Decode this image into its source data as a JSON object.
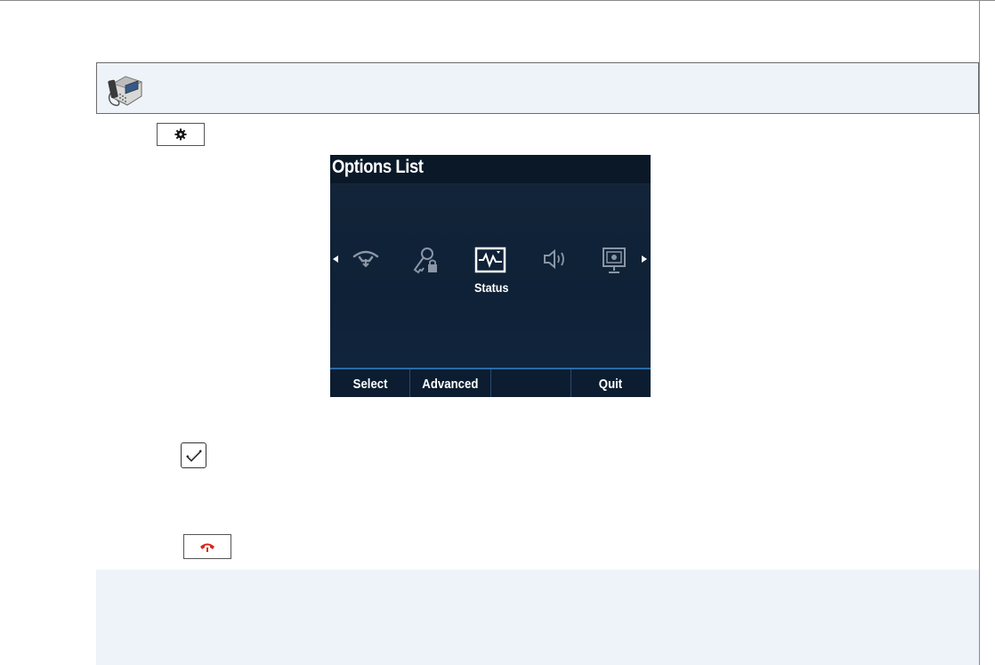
{
  "screen": {
    "title": "Options List",
    "icons": [
      "network-icon",
      "admin-key-lock-icon",
      "status-icon",
      "speaker-volume-icon",
      "display-settings-icon"
    ],
    "selected_label": "Status",
    "softkeys": [
      {
        "label": "Select"
      },
      {
        "label": "Advanced"
      },
      {
        "label": ""
      },
      {
        "label": "Quit"
      }
    ]
  },
  "keys": {
    "gear": "gear-icon",
    "check": "checkmark-icon",
    "end": "end-call-icon"
  },
  "colors": {
    "banner_bg": "#eef3f9",
    "screen_bg": "#0f2136",
    "softkey_border": "#2b6aa8",
    "end_call_red": "#d9261c"
  }
}
